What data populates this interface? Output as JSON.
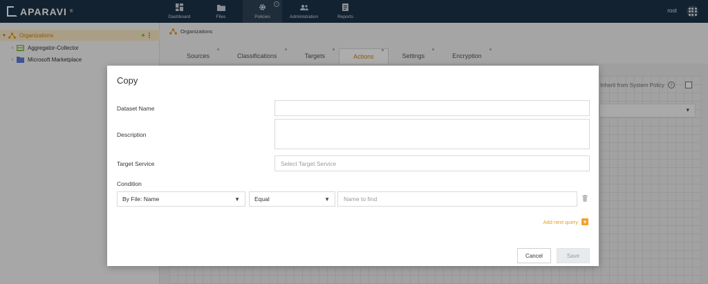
{
  "app": {
    "logo_text": "APARAVI",
    "logo_tm": "®"
  },
  "nav": {
    "items": [
      {
        "label": "Dashboard",
        "icon": "dashboard-icon"
      },
      {
        "label": "Files",
        "icon": "folder-icon"
      },
      {
        "label": "Policies",
        "icon": "gear-icon",
        "active": true
      },
      {
        "label": "Administration",
        "icon": "users-icon"
      },
      {
        "label": "Reports",
        "icon": "report-icon"
      }
    ],
    "user": "root"
  },
  "sidebar": {
    "items": [
      {
        "label": "Organizations",
        "selected": true
      },
      {
        "label": "Aggregator-Collector"
      },
      {
        "label": "Microsoft Marketplace"
      }
    ]
  },
  "breadcrumb": "Organizations",
  "tabs": [
    "Sources",
    "Classifications",
    "Targets",
    "Actions",
    "Settings",
    "Encryption"
  ],
  "active_tab": "Actions",
  "background": {
    "inherit_label": "Inherit from System Policy"
  },
  "modal": {
    "title": "Copy",
    "dataset_name_label": "Dataset Name",
    "dataset_name_value": "",
    "description_label": "Description",
    "description_value": "",
    "target_service_label": "Target Service",
    "target_service_placeholder": "Select Target Service",
    "condition_label": "Condition",
    "condition": {
      "field": "By File: Name",
      "operator": "Equal",
      "value_placeholder": "Name to find"
    },
    "add_query_label": "Add next query",
    "cancel_label": "Cancel",
    "save_label": "Save"
  },
  "colors": {
    "nav_bg": "#1c3348",
    "accent": "#e89a1f",
    "selected_row": "#fbe9c8"
  }
}
